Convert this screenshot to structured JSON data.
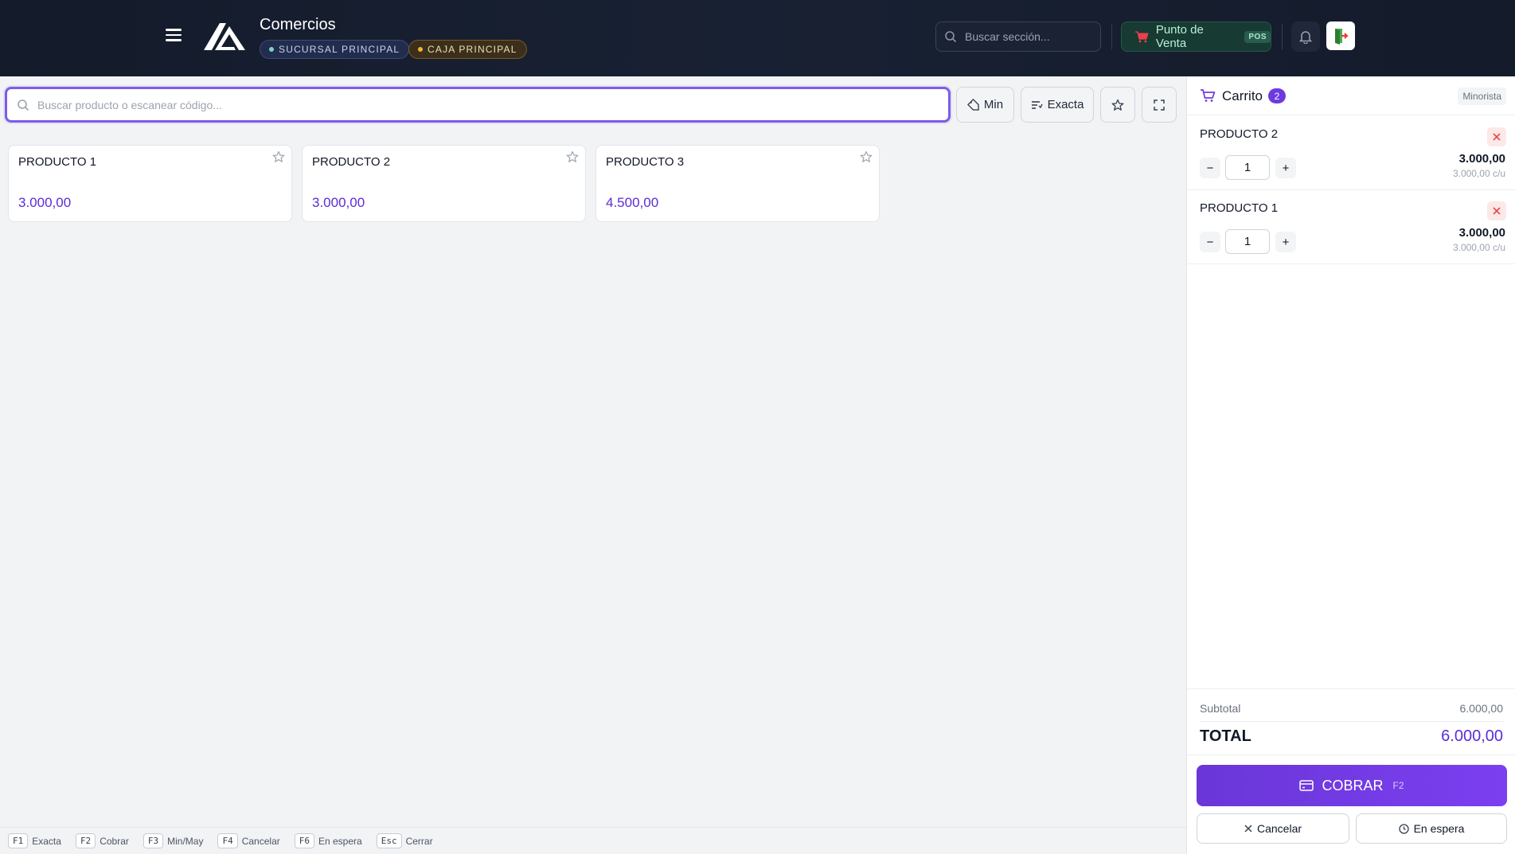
{
  "header": {
    "brand": "Comercios",
    "branch_badge": "SUCURSAL PRINCIPAL",
    "cash_badge": "CAJA PRINCIPAL",
    "search_placeholder": "Buscar sección...",
    "pos_label": "Punto de Venta",
    "pos_tag": "POS"
  },
  "main": {
    "search_placeholder": "Buscar producto o escanear código...",
    "tools": {
      "min_label": "Min",
      "exact_label": "Exacta"
    },
    "products": [
      {
        "name": "PRODUCTO 1",
        "price": "3.000,00"
      },
      {
        "name": "PRODUCTO 2",
        "price": "3.000,00"
      },
      {
        "name": "PRODUCTO 3",
        "price": "4.500,00"
      }
    ]
  },
  "shortcuts": [
    {
      "key": "F1",
      "label": "Exacta"
    },
    {
      "key": "F2",
      "label": "Cobrar"
    },
    {
      "key": "F3",
      "label": "Min/May"
    },
    {
      "key": "F4",
      "label": "Cancelar"
    },
    {
      "key": "F6",
      "label": "En espera"
    },
    {
      "key": "Esc",
      "label": "Cerrar"
    }
  ],
  "cart": {
    "title": "Carrito",
    "count": "2",
    "tier": "Minorista",
    "items": [
      {
        "name": "PRODUCTO 2",
        "qty": "1",
        "total": "3.000,00",
        "unit": "3.000,00 c/u"
      },
      {
        "name": "PRODUCTO 1",
        "qty": "1",
        "total": "3.000,00",
        "unit": "3.000,00 c/u"
      }
    ],
    "subtotal_label": "Subtotal",
    "subtotal": "6.000,00",
    "total_label": "TOTAL",
    "total": "6.000,00",
    "pay_label": "COBRAR",
    "pay_key": "F2",
    "cancel_label": "Cancelar",
    "hold_label": "En espera"
  },
  "colors": {
    "accent": "#6d3ae0",
    "price": "#5b2bd6",
    "header_bg": "#141b2b",
    "pos_green": "#173a33"
  }
}
